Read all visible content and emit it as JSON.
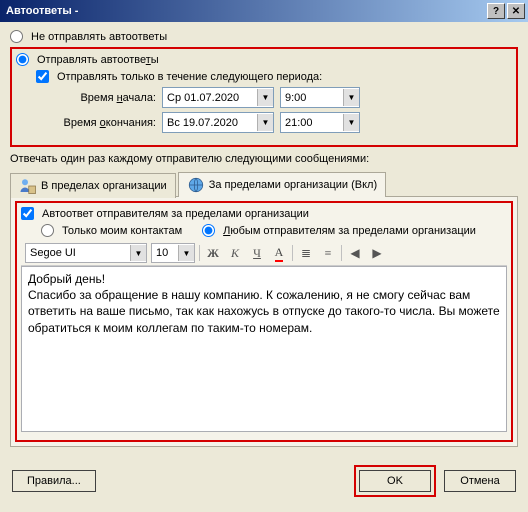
{
  "title": "Автоответы -",
  "radio_no_send": "Не отправлять автоответы",
  "radio_send": "Отправлять автоответы",
  "chk_period": "Отправлять только в течение следующего периода:",
  "label_start": "Время начала:",
  "label_end": "Время окончания:",
  "date_start": "Ср 01.07.2020",
  "date_end": "Вс 19.07.2020",
  "time_start": "9:00",
  "time_end": "21:00",
  "reply_once": "Отвечать один раз каждому отправителю следующими сообщениями:",
  "tab_inside": "В пределах организации",
  "tab_outside": "За пределами организации (Вкл)",
  "chk_autoreply_outside": "Автоответ отправителям за пределами организации",
  "radio_contacts_only": "Только моим контактам",
  "radio_any_sender": "Любым отправителям за пределами организации",
  "font_name": "Segoe UI",
  "font_size": "10",
  "editor_text": "Добрый день!\nСпасибо за обращение в нашу компанию. К сожалению, я не смогу сейчас вам ответить на ваше письмо, так как нахожусь в отпуске до такого-то числа. Вы можете обратиться к моим коллегам по таким-то номерам.",
  "btn_rules": "Правила...",
  "btn_ok": "OK",
  "btn_cancel": "Отмена"
}
